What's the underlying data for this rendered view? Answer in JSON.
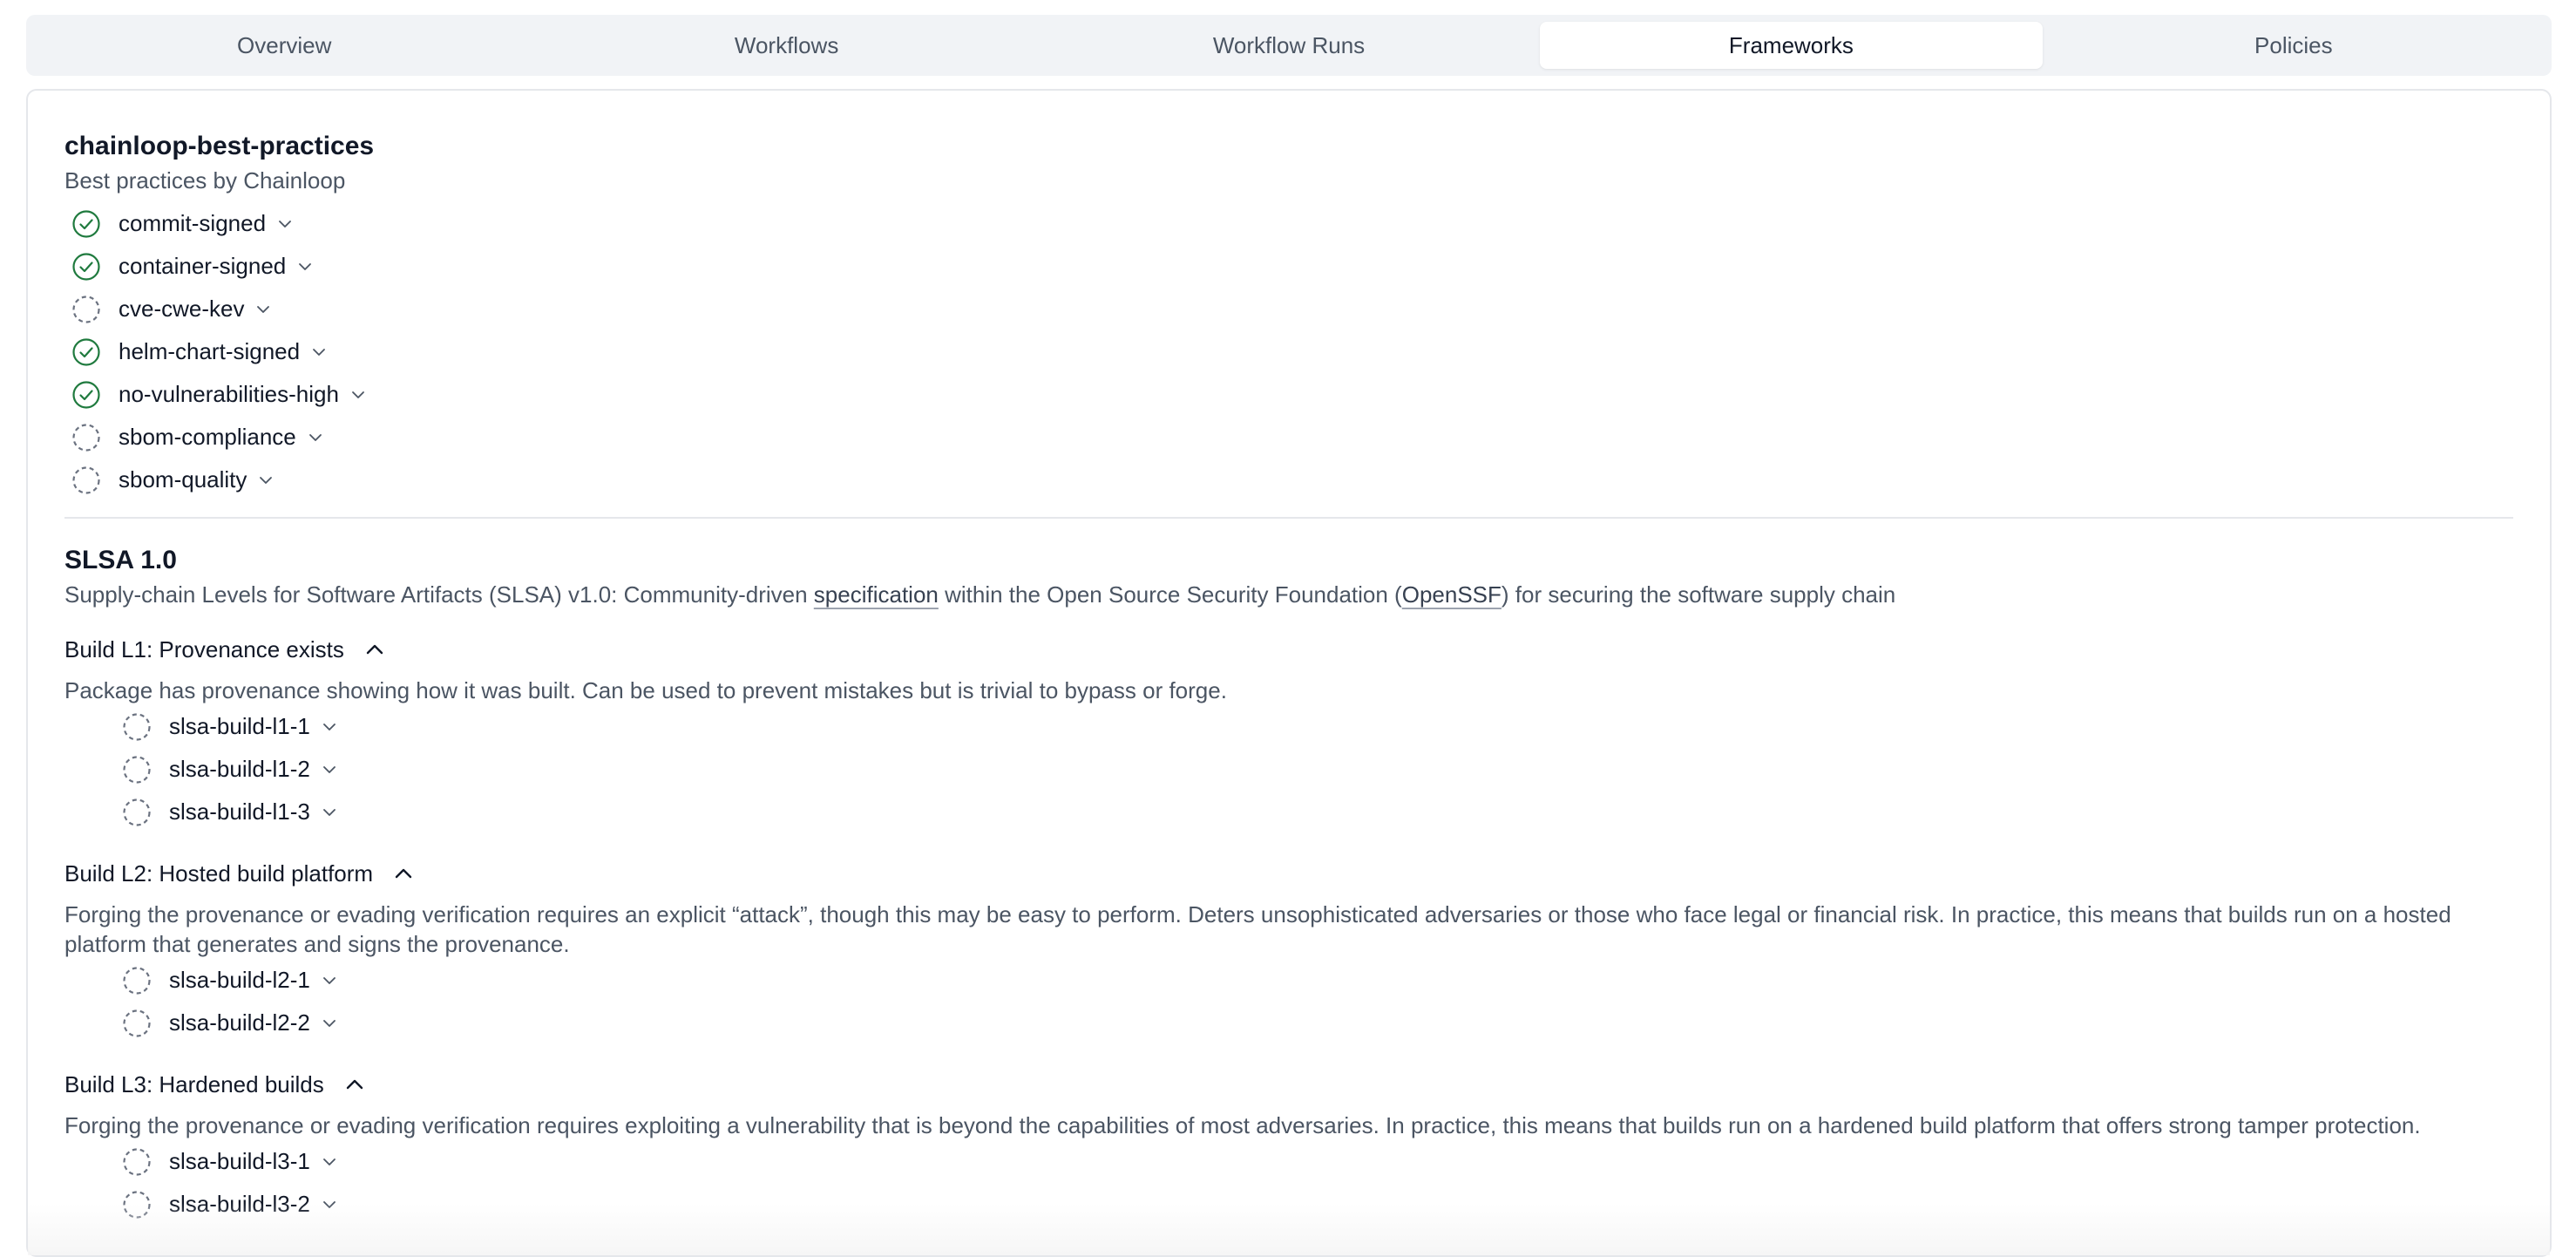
{
  "tabs": [
    {
      "label": "Overview",
      "active": false
    },
    {
      "label": "Workflows",
      "active": false
    },
    {
      "label": "Workflow Runs",
      "active": false
    },
    {
      "label": "Frameworks",
      "active": true
    },
    {
      "label": "Policies",
      "active": false
    }
  ],
  "colors": {
    "passed": "#1f7a3e",
    "pending": "#6b7280"
  },
  "framework1": {
    "title": "chainloop-best-practices",
    "description": "Best practices by Chainloop",
    "controls": [
      {
        "name": "commit-signed",
        "status": "passed"
      },
      {
        "name": "container-signed",
        "status": "passed"
      },
      {
        "name": "cve-cwe-kev",
        "status": "pending"
      },
      {
        "name": "helm-chart-signed",
        "status": "passed"
      },
      {
        "name": "no-vulnerabilities-high",
        "status": "passed"
      },
      {
        "name": "sbom-compliance",
        "status": "pending"
      },
      {
        "name": "sbom-quality",
        "status": "pending"
      }
    ]
  },
  "framework2": {
    "title": "SLSA 1.0",
    "desc_pre": "Supply-chain Levels for Software Artifacts (SLSA) v1.0: Community-driven ",
    "desc_link1": "specification",
    "desc_mid": " within the Open Source Security Foundation (",
    "desc_link2": "OpenSSF",
    "desc_post": ") for securing the software supply chain",
    "levels": [
      {
        "title": "Build L1: Provenance exists",
        "description": "Package has provenance showing how it was built. Can be used to prevent mistakes but is trivial to bypass or forge.",
        "controls": [
          "slsa-build-l1-1",
          "slsa-build-l1-2",
          "slsa-build-l1-3"
        ]
      },
      {
        "title": "Build L2: Hosted build platform",
        "description": "Forging the provenance or evading verification requires an explicit “attack”, though this may be easy to perform. Deters unsophisticated adversaries or those who face legal or financial risk. In practice, this means that builds run on a hosted platform that generates and signs the provenance.",
        "controls": [
          "slsa-build-l2-1",
          "slsa-build-l2-2"
        ]
      },
      {
        "title": "Build L3: Hardened builds",
        "description": "Forging the provenance or evading verification requires exploiting a vulnerability that is beyond the capabilities of most adversaries. In practice, this means that builds run on a hardened build platform that offers strong tamper protection.",
        "controls": [
          "slsa-build-l3-1",
          "slsa-build-l3-2"
        ]
      }
    ]
  }
}
